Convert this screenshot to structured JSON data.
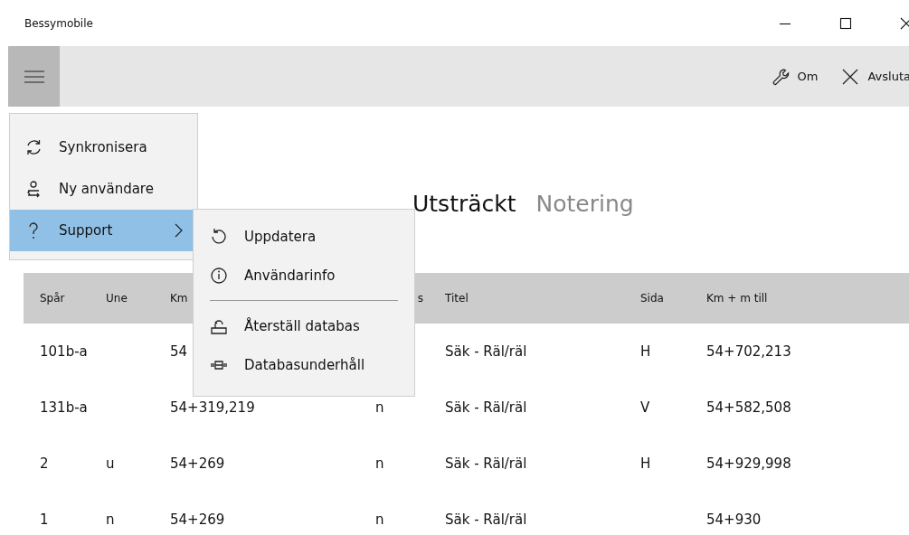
{
  "window": {
    "title": "Bessymobile"
  },
  "toolbar": {
    "actions": [
      {
        "label": "Om",
        "kind": "about"
      },
      {
        "label": "Avsluta",
        "kind": "exit"
      }
    ]
  },
  "menu": {
    "items": [
      {
        "label": "Synkronisera",
        "kind": "sync",
        "selected": false,
        "submenu": false
      },
      {
        "label": "Ny användare",
        "kind": "user",
        "selected": false,
        "submenu": false
      },
      {
        "label": "Support",
        "kind": "help",
        "selected": true,
        "submenu": true
      }
    ]
  },
  "submenu": {
    "items": [
      {
        "label": "Uppdatera",
        "kind": "refresh"
      },
      {
        "label": "Användarinfo",
        "kind": "info"
      },
      {
        "kind": "separator"
      },
      {
        "label": "Återställ databas",
        "kind": "restore"
      },
      {
        "label": "Databasunderhåll",
        "kind": "maintenance"
      }
    ]
  },
  "tabs": [
    {
      "label": "Utsträckt",
      "selected": true
    },
    {
      "label": "Notering",
      "selected": false
    }
  ],
  "table": {
    "columns": [
      "Spår",
      "Une",
      "Km",
      "s",
      "Titel",
      "Sida",
      "Km + m till"
    ],
    "rows": [
      [
        "101b-a",
        null,
        "54",
        null,
        "Säk - Räl/räl",
        "H",
        "54+702,213"
      ],
      [
        "131b-a",
        null,
        "54+319,219",
        "n",
        "Säk - Räl/räl",
        "V",
        "54+582,508"
      ],
      [
        "2",
        "u",
        "54+269",
        "n",
        "Säk - Räl/räl",
        "H",
        "54+929,998"
      ],
      [
        "1",
        "n",
        "54+269",
        "n",
        "Säk - Räl/räl",
        null,
        "54+930"
      ]
    ]
  }
}
